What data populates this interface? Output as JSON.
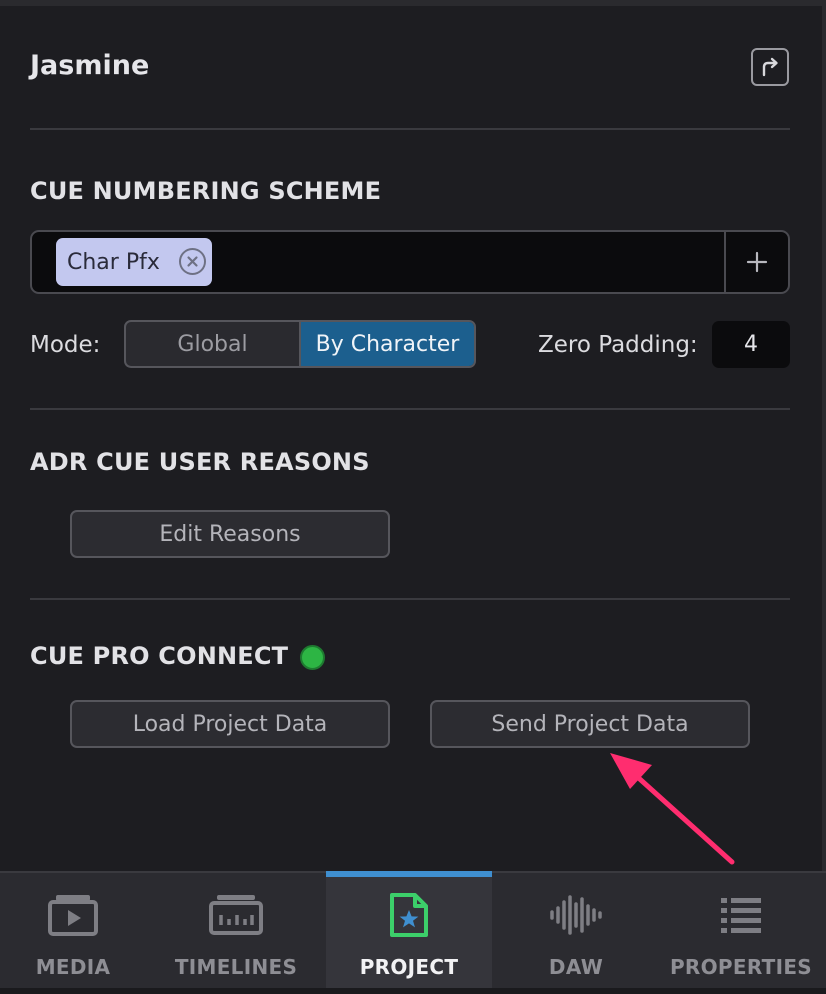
{
  "header": {
    "title": "Jasmine",
    "share_icon": "share-arrow-icon"
  },
  "cue_numbering": {
    "title": "CUE NUMBERING SCHEME",
    "tokens": [
      {
        "label": "Char Pfx"
      }
    ],
    "add_icon": "plus-icon",
    "mode_label": "Mode:",
    "modes": [
      {
        "label": "Global",
        "active": false
      },
      {
        "label": "By Character",
        "active": true
      }
    ],
    "zero_padding_label": "Zero Padding:",
    "zero_padding_value": "4"
  },
  "adr_reasons": {
    "title": "ADR CUE USER REASONS",
    "edit_label": "Edit Reasons"
  },
  "cue_pro_connect": {
    "title": "CUE PRO CONNECT",
    "status_color": "#2db544",
    "load_label": "Load Project Data",
    "send_label": "Send Project Data"
  },
  "annotation": {
    "arrow_color": "#ff2d6f"
  },
  "tabs": [
    {
      "label": "MEDIA",
      "icon": "media-icon",
      "active": false
    },
    {
      "label": "TIMELINES",
      "icon": "timelines-icon",
      "active": false
    },
    {
      "label": "PROJECT",
      "icon": "project-icon",
      "active": true
    },
    {
      "label": "DAW",
      "icon": "daw-waveform-icon",
      "active": false
    },
    {
      "label": "PROPERTIES",
      "icon": "properties-list-icon",
      "active": false
    }
  ],
  "colors": {
    "accent": "#1c5f8e",
    "tab_indicator": "#3f8fd0",
    "project_icon": "#3ccf6a"
  }
}
